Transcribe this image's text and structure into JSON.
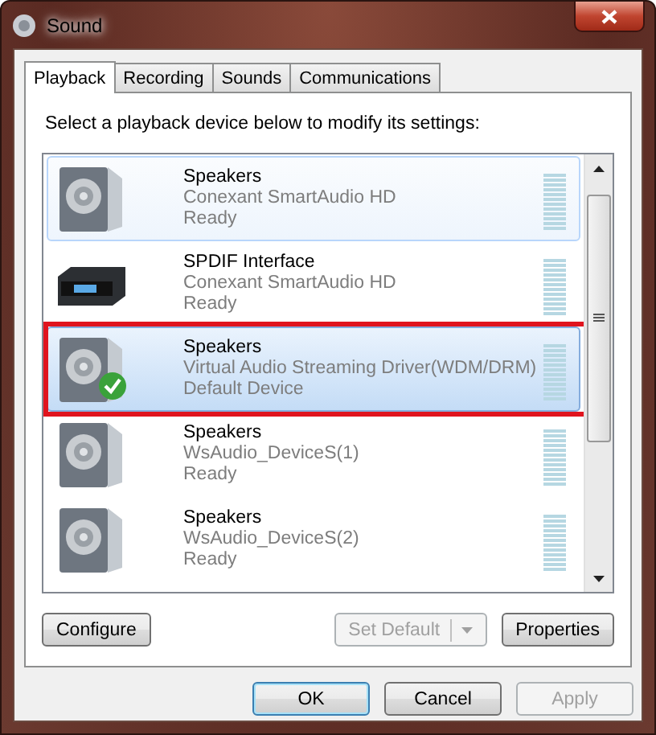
{
  "window": {
    "title": "Sound"
  },
  "tabs": [
    {
      "label": "Playback",
      "selected": true
    },
    {
      "label": "Recording",
      "selected": false
    },
    {
      "label": "Sounds",
      "selected": false
    },
    {
      "label": "Communications",
      "selected": false
    }
  ],
  "instruction": "Select a playback device below to modify its settings:",
  "devices": [
    {
      "kind": "speaker",
      "name": "Speakers",
      "driver": "Conexant SmartAudio HD",
      "status": "Ready",
      "selected": false,
      "hovered": true,
      "default": false,
      "highlighted": false
    },
    {
      "kind": "spdif",
      "name": "SPDIF Interface",
      "driver": "Conexant SmartAudio HD",
      "status": "Ready",
      "selected": false,
      "hovered": false,
      "default": false,
      "highlighted": false
    },
    {
      "kind": "speaker",
      "name": "Speakers",
      "driver": "Virtual Audio Streaming Driver(WDM/DRM)",
      "status": "Default Device",
      "selected": true,
      "hovered": false,
      "default": true,
      "highlighted": true
    },
    {
      "kind": "speaker",
      "name": "Speakers",
      "driver": "WsAudio_DeviceS(1)",
      "status": "Ready",
      "selected": false,
      "hovered": false,
      "default": false,
      "highlighted": false
    },
    {
      "kind": "speaker",
      "name": "Speakers",
      "driver": "WsAudio_DeviceS(2)",
      "status": "Ready",
      "selected": false,
      "hovered": false,
      "default": false,
      "highlighted": false
    }
  ],
  "panel_buttons": [
    {
      "label": "Configure",
      "disabled": false,
      "split": false
    },
    {
      "label": "Set Default",
      "disabled": true,
      "split": true
    },
    {
      "label": "Properties",
      "disabled": false,
      "split": false
    }
  ],
  "dialog_buttons": [
    {
      "label": "OK",
      "disabled": false,
      "default": true
    },
    {
      "label": "Cancel",
      "disabled": false,
      "default": false
    },
    {
      "label": "Apply",
      "disabled": true,
      "default": false
    }
  ]
}
